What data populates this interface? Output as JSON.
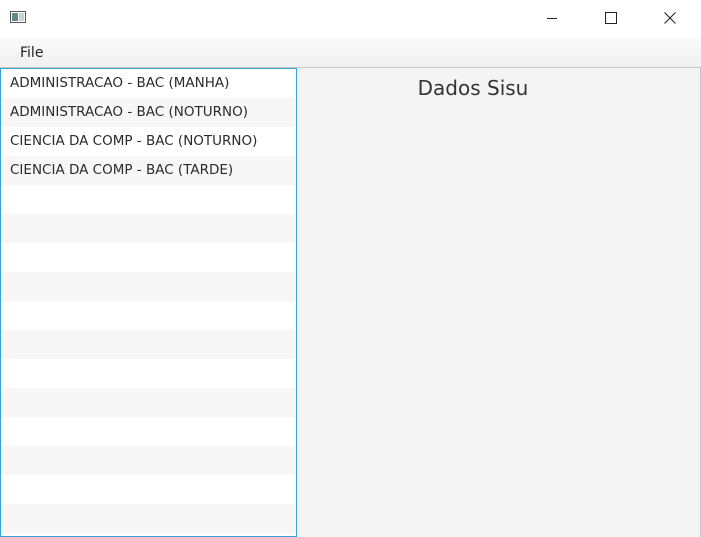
{
  "window": {
    "title": "",
    "controls": {
      "minimize": "minimize-icon",
      "maximize": "maximize-icon",
      "close": "close-icon"
    }
  },
  "menubar": {
    "items": [
      {
        "label": "File"
      }
    ]
  },
  "course_list": {
    "items": [
      {
        "label": "ADMINISTRACAO - BAC (MANHA)"
      },
      {
        "label": "ADMINISTRACAO - BAC (NOTURNO)"
      },
      {
        "label": "CIENCIA DA COMP - BAC (NOTURNO)"
      },
      {
        "label": "CIENCIA DA COMP - BAC (TARDE)"
      }
    ],
    "selection_color": "#3aa0d8"
  },
  "detail_panel": {
    "title": "Dados Sisu"
  }
}
